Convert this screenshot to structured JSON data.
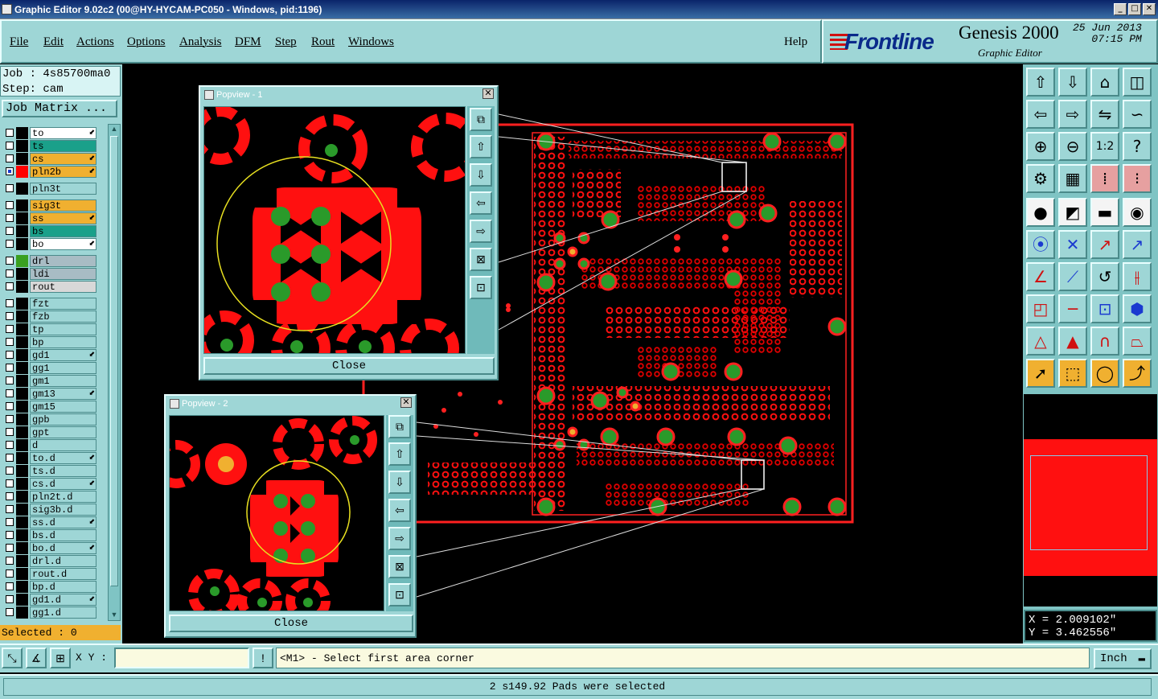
{
  "window": {
    "title": "Graphic Editor 9.02c2 (00@HY-HYCAM-PC050 - Windows, pid:1196)"
  },
  "menu": [
    "File",
    "Edit",
    "Actions",
    "Options",
    "Analysis",
    "DFM",
    "Step",
    "Rout",
    "Windows"
  ],
  "help": "Help",
  "brand": {
    "logo": "Frontline",
    "product": "Genesis 2000",
    "subtitle": "Graphic Editor",
    "date": "25 Jun 2013",
    "time": "07:15 PM"
  },
  "job": {
    "job_line": "Job : 4s85700ma0",
    "step_line": "Step: cam",
    "matrix_button": "Job Matrix ..."
  },
  "layers": [
    {
      "name": "to",
      "color": "#ffffff",
      "tag": "#000000",
      "arrow": true
    },
    {
      "name": "ts",
      "color": "#1aa08a",
      "tag": "#000000",
      "arrow": false
    },
    {
      "name": "cs",
      "color": "#f0b030",
      "tag": "#000000",
      "arrow": true
    },
    {
      "name": "pln2b",
      "color": "#f0b030",
      "tag": "#ff0000",
      "arrow": true,
      "checked": true
    },
    {
      "name": "pln3t",
      "color": "#9ed6d6",
      "tag": "#000000",
      "arrow": false
    },
    {
      "name": "sig3t",
      "color": "#f0b030",
      "tag": "#000000",
      "arrow": false
    },
    {
      "name": "ss",
      "color": "#f0b030",
      "tag": "#000000",
      "arrow": true
    },
    {
      "name": "bs",
      "color": "#1aa08a",
      "tag": "#000000",
      "arrow": false
    },
    {
      "name": "bo",
      "color": "#ffffff",
      "tag": "#000000",
      "arrow": true
    },
    {
      "name": "drl",
      "color": "#a8bcc4",
      "tag": "#3aa020",
      "arrow": false
    },
    {
      "name": "ldi",
      "color": "#a8bcc4",
      "tag": "#000000",
      "arrow": false
    },
    {
      "name": "rout",
      "color": "#d8d8d8",
      "tag": "#000000",
      "arrow": false
    },
    {
      "name": "fzt",
      "color": "#9ed6d6",
      "tag": "#000000",
      "arrow": false
    },
    {
      "name": "fzb",
      "color": "#9ed6d6",
      "tag": "#000000",
      "arrow": false
    },
    {
      "name": "tp",
      "color": "#9ed6d6",
      "tag": "#000000",
      "arrow": false
    },
    {
      "name": "bp",
      "color": "#9ed6d6",
      "tag": "#000000",
      "arrow": false
    },
    {
      "name": "gd1",
      "color": "#9ed6d6",
      "tag": "#000000",
      "arrow": true
    },
    {
      "name": "gg1",
      "color": "#9ed6d6",
      "tag": "#000000",
      "arrow": false
    },
    {
      "name": "gm1",
      "color": "#9ed6d6",
      "tag": "#000000",
      "arrow": false
    },
    {
      "name": "gm13",
      "color": "#9ed6d6",
      "tag": "#000000",
      "arrow": true
    },
    {
      "name": "gm15",
      "color": "#9ed6d6",
      "tag": "#000000",
      "arrow": false
    },
    {
      "name": "gpb",
      "color": "#9ed6d6",
      "tag": "#000000",
      "arrow": false
    },
    {
      "name": "gpt",
      "color": "#9ed6d6",
      "tag": "#000000",
      "arrow": false
    },
    {
      "name": "d",
      "color": "#9ed6d6",
      "tag": "#000000",
      "arrow": false
    },
    {
      "name": "to.d",
      "color": "#9ed6d6",
      "tag": "#000000",
      "arrow": true
    },
    {
      "name": "ts.d",
      "color": "#9ed6d6",
      "tag": "#000000",
      "arrow": false
    },
    {
      "name": "cs.d",
      "color": "#9ed6d6",
      "tag": "#000000",
      "arrow": true
    },
    {
      "name": "pln2t.d",
      "color": "#9ed6d6",
      "tag": "#000000",
      "arrow": false
    },
    {
      "name": "sig3b.d",
      "color": "#9ed6d6",
      "tag": "#000000",
      "arrow": false
    },
    {
      "name": "ss.d",
      "color": "#9ed6d6",
      "tag": "#000000",
      "arrow": true
    },
    {
      "name": "bs.d",
      "color": "#9ed6d6",
      "tag": "#000000",
      "arrow": false
    },
    {
      "name": "bo.d",
      "color": "#9ed6d6",
      "tag": "#000000",
      "arrow": true
    },
    {
      "name": "drl.d",
      "color": "#9ed6d6",
      "tag": "#000000",
      "arrow": false
    },
    {
      "name": "rout.d",
      "color": "#9ed6d6",
      "tag": "#000000",
      "arrow": false
    },
    {
      "name": "bp.d",
      "color": "#9ed6d6",
      "tag": "#000000",
      "arrow": false
    },
    {
      "name": "gd1.d",
      "color": "#9ed6d6",
      "tag": "#000000",
      "arrow": true
    },
    {
      "name": "gg1.d",
      "color": "#9ed6d6",
      "tag": "#000000",
      "arrow": false
    }
  ],
  "selected_count": "Selected : 0",
  "popview1": {
    "title": "Popview - 1",
    "close": "Close"
  },
  "popview2": {
    "title": "Popview - 2",
    "close": "Close"
  },
  "coords": {
    "x": "X = 2.009102\"",
    "y": "Y = 3.462556\""
  },
  "bottom": {
    "xy_label": "X Y :",
    "xy_value": "",
    "message": "<M1> - Select first area corner",
    "unit": "Inch"
  },
  "status": "2 s149.92 Pads were selected",
  "colors": {
    "panel": "#9ed6d6",
    "pad": "#ff0000",
    "via_plated": "#3aa020",
    "highlight": "#f0b030",
    "selection_circle": "#e8e020"
  }
}
